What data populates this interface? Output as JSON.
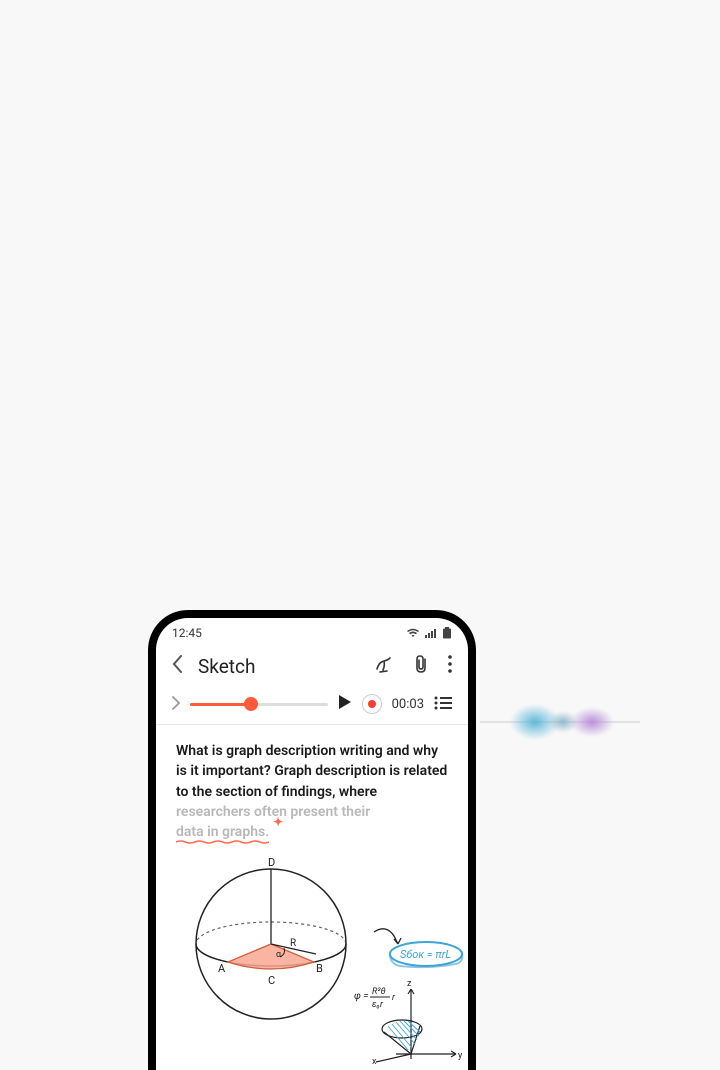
{
  "status": {
    "time": "12:45"
  },
  "header": {
    "title": "Sketch"
  },
  "playback": {
    "progress_pct": 44,
    "timer": "00:03"
  },
  "note": {
    "text_main": "What is graph description writing and why is it important? Graph description is related to the section of findings, where ",
    "text_faded_1": "researchers often present their ",
    "text_underlined": "data in graphs.",
    "text_faded_2": ""
  },
  "sketch": {
    "labels": {
      "A": "A",
      "B": "B",
      "C": "C",
      "D": "D",
      "R": "R"
    },
    "formula1": "Sбок = πrL",
    "formula2_lhs": "φ =",
    "formula2_frac_top": "R²θ",
    "formula2_frac_bot": "ε₀r",
    "formula2_rhs": "r",
    "axes": {
      "x": "x",
      "y": "y",
      "z": "z"
    }
  },
  "colors": {
    "accent": "#ff5a3c",
    "record": "#ff3b30",
    "faded_text": "#b8b8b8",
    "wave_blue": "#5eb8d9",
    "wave_purple": "#b88fd9",
    "highlight_blue": "#3fa4d6",
    "sector_fill": "#f8a890"
  }
}
